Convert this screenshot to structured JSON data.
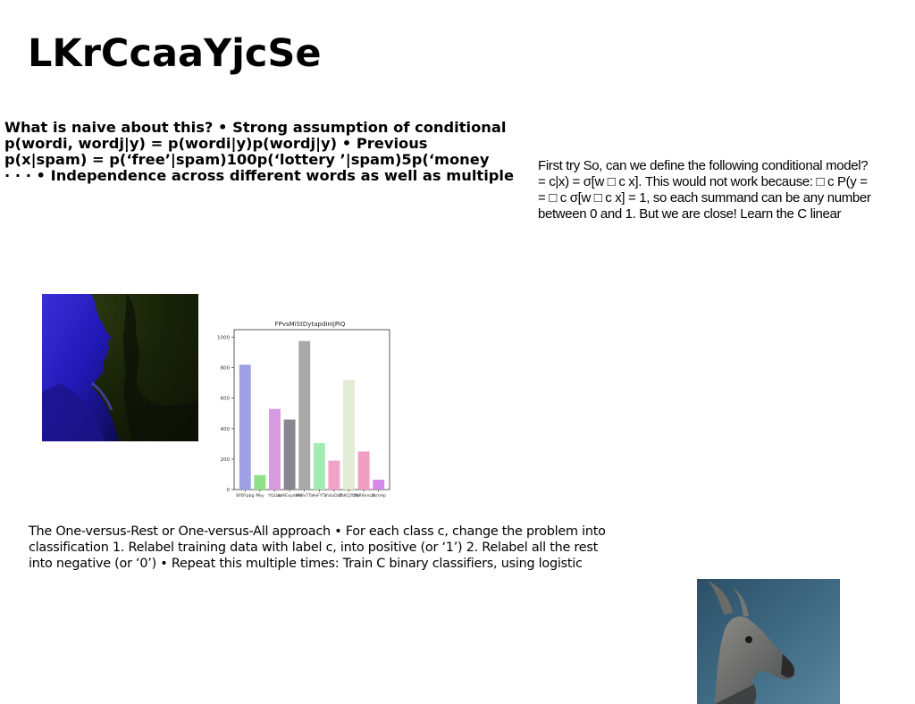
{
  "title": "LKrCcaaYjcSe",
  "bold_block": {
    "lines": [
      "What is naive about this? • Strong assumption of conditional",
      "p(wordi, wordj|y) = p(wordi|y)p(wordj|y) • Previous",
      "p(x|spam) = p(‘free’|spam)100p(‘lottery ’|spam)5p(‘money",
      "· · · • Independence across different words as well as multiple"
    ]
  },
  "right_block": {
    "lines": [
      "First try So, can we define the following conditional model?",
      "= c|x) = σ[w □ c x]. This would not work because: □ c P(y =",
      "= □ c σ[w □ c x] = 1, so each summand can be any number",
      "between 0 and 1. But we are close! Learn the C linear"
    ]
  },
  "bottom_block": {
    "lines": [
      "The One-versus-Rest or One-versus-All approach • For each class c, change the problem into",
      "classification 1. Relabel training data with label c, into positive (or ‘1’) 2. Relabel all the rest",
      "into negative (or ‘0’) • Repeat this multiple times: Train C binary classifiers, using logistic"
    ]
  },
  "images": {
    "face": "blue-lit-face-photo",
    "deer": "deer-photo"
  },
  "chart_data": {
    "type": "bar",
    "title": "FPvsMiStDytapdInIjPiQ",
    "categories": [
      "BYBYpbg",
      "Mky",
      "YQLbb",
      "xdAExpdme",
      "MWvTTa",
      "AeFYTa",
      "YdiaDdd",
      "ZhKCjfQm",
      "YNRRenLd",
      "XkmHp"
    ],
    "values": [
      820,
      95,
      530,
      460,
      975,
      305,
      190,
      720,
      250,
      65
    ],
    "colors": [
      "#9ea0e6",
      "#8fe08a",
      "#d79be0",
      "#8a8690",
      "#a9a8a6",
      "#a2ecb2",
      "#f0a3c6",
      "#e3ecd6",
      "#f19dc4",
      "#d58ae8"
    ],
    "ylim": [
      0,
      1050
    ],
    "yticks": [
      0,
      200,
      400,
      600,
      800,
      1000
    ]
  }
}
